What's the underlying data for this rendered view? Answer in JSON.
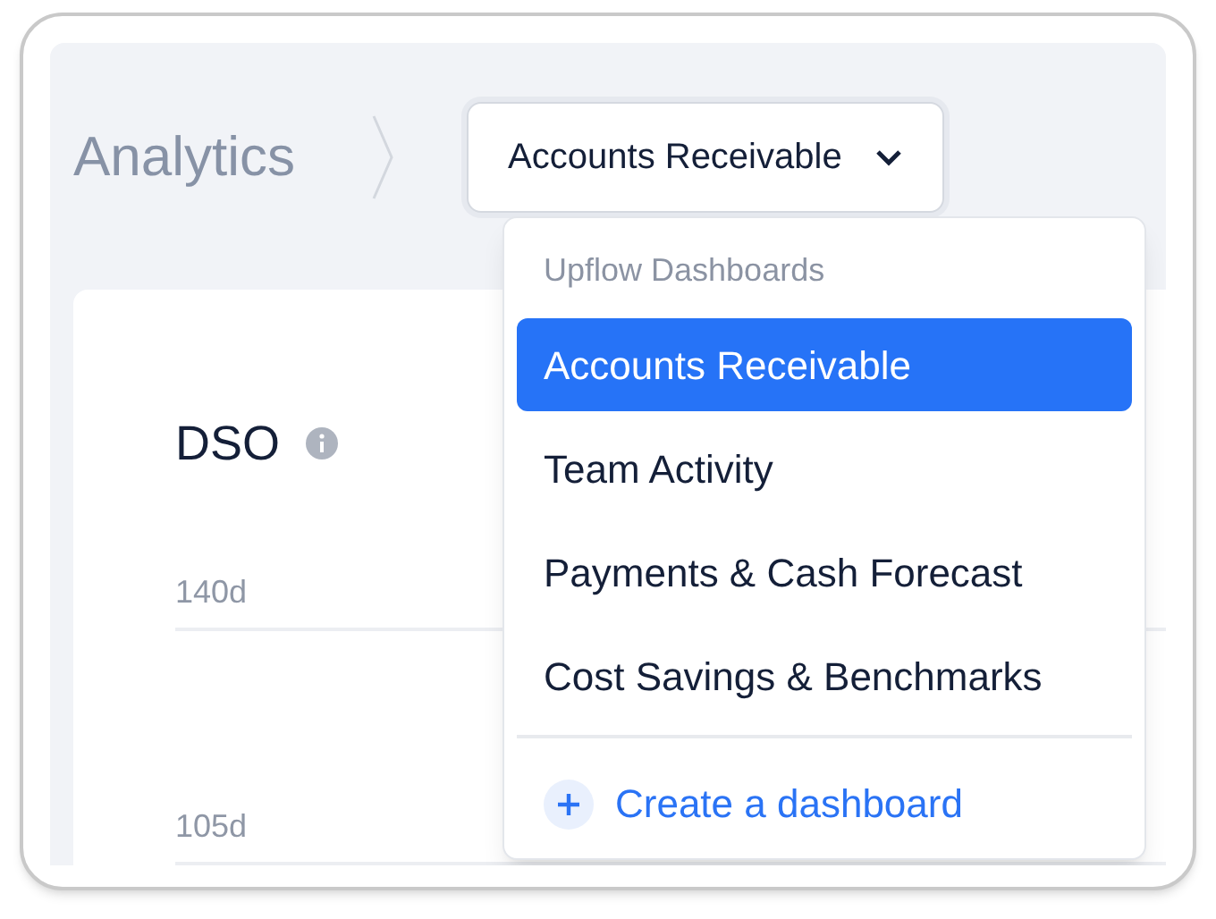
{
  "breadcrumb": {
    "section": "Analytics"
  },
  "dashboard_select": {
    "value": "Accounts Receivable"
  },
  "card": {
    "title": "DSO",
    "y_labels": [
      "140d",
      "105d"
    ]
  },
  "menu": {
    "heading": "Upflow Dashboards",
    "items": [
      {
        "label": "Accounts Receivable",
        "selected": true
      },
      {
        "label": "Team Activity",
        "selected": false
      },
      {
        "label": "Payments & Cash Forecast",
        "selected": false
      },
      {
        "label": "Cost Savings & Benchmarks",
        "selected": false
      }
    ],
    "action": "Create a dashboard"
  }
}
